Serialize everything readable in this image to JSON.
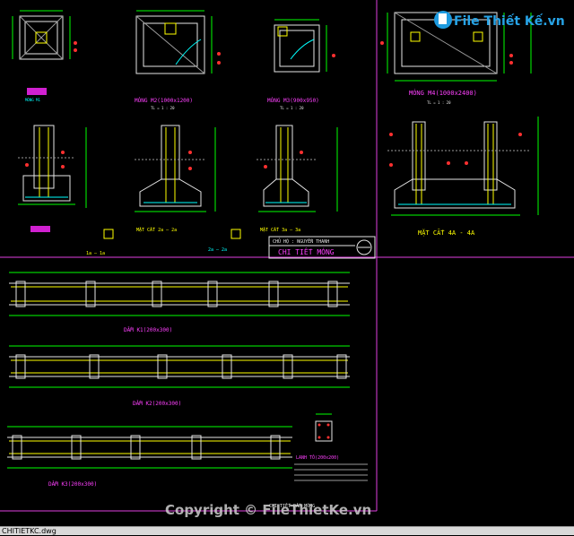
{
  "watermark": {
    "logo_text": "File Thiết Kế.vn",
    "copyright": "Copyright © FileThietKe.vn"
  },
  "drawing": {
    "footing_m1": "MÓNG M1",
    "footing_m2": "MÓNG M2(1000x1200)",
    "footing_m3": "MÓNG M3(900x950)",
    "footing_m4": "MÓNG M4(1000x2400)",
    "scale_note": "TL = 1 : 20",
    "section_1a": "1a — 1a",
    "section_2a": "MẶT CẮT 2a — 2a",
    "section_3a": "MẶT CẮT 3a — 3a",
    "section_4a": "MẶT CẮT 4A - 4A",
    "title_small": "CHỦ HỘ : NGUYỄN THANH",
    "title_main": "CHI TIẾT MÓNG",
    "beam_1": "DẦM K1(200x300)",
    "beam_2": "DẦM K2(200x300)",
    "beam_3": "DẦM K3(200x300)",
    "lintel": "LANH TÔ(200x200)",
    "bottom_note": "CHI TIẾT DẦM MÓNG"
  },
  "status": {
    "file_name": "CHITIETKC.dwg"
  }
}
